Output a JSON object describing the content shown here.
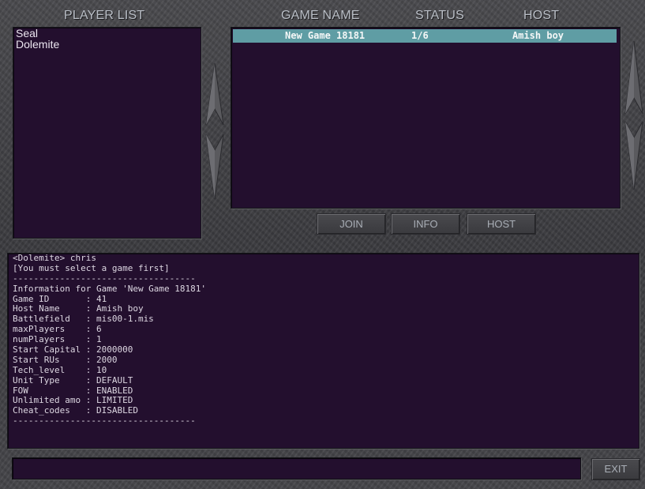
{
  "headers": {
    "player_list": "PLAYER LIST",
    "game_name": "GAME NAME",
    "status": "STATUS",
    "host": "HOST"
  },
  "players": [
    "Seal",
    "Dolemite"
  ],
  "games": [
    {
      "name": "New Game 18181",
      "status": "1/6",
      "host": "Amish boy",
      "selected": true
    }
  ],
  "buttons": {
    "join": "JOIN",
    "info": "INFO",
    "host": "HOST",
    "exit": "EXIT"
  },
  "console_lines": [
    "<Dolemite> chris",
    "[You must select a game first]",
    "-----------------------------------",
    "Information for Game 'New Game 18181'",
    "Game ID       : 41",
    "Host Name     : Amish boy",
    "Battlefield   : mis00-1.mis",
    "maxPlayers    : 6",
    "numPlayers    : 1",
    "Start Capital : 2000000",
    "Start RUs     : 2000",
    "Tech_level    : 10",
    "Unit Type     : DEFAULT",
    "FOW           : ENABLED",
    "Unlimited amo : LIMITED",
    "Cheat_codes   : DISABLED",
    "-----------------------------------"
  ],
  "chat_input": {
    "value": "",
    "placeholder": ""
  },
  "colors": {
    "pane_bg": "#230f2e",
    "selected_row": "#5f9da4",
    "frame": "#444448"
  },
  "icons": [
    "scroll-up-arrow-icon",
    "scroll-down-arrow-icon"
  ]
}
